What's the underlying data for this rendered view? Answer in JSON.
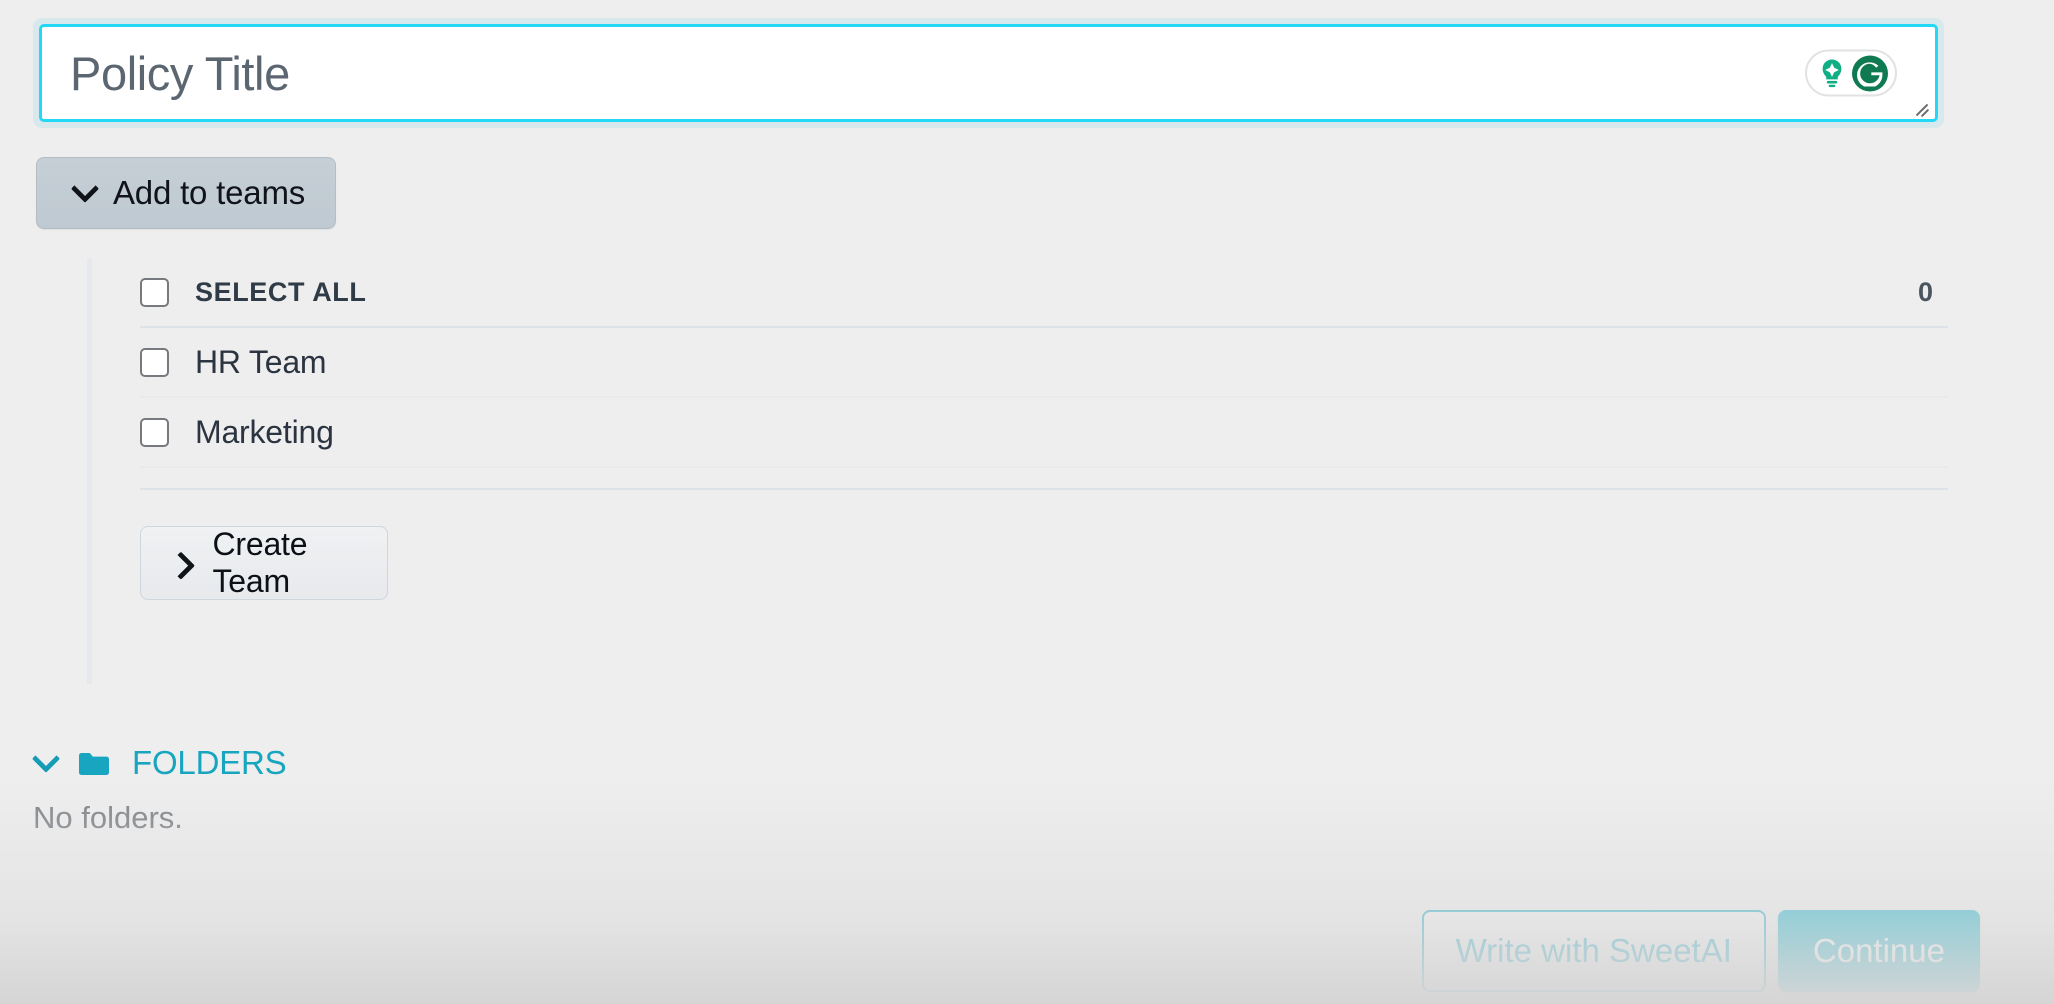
{
  "title_input": {
    "placeholder": "Policy Title",
    "value": "",
    "assistant_icons": [
      "grammarly-suggestion-bulb-icon",
      "grammarly-logo-icon"
    ]
  },
  "add_to_teams": {
    "label": "Add to teams",
    "chevron": "chevron-down-icon"
  },
  "teams_panel": {
    "select_all_label": "SELECT ALL",
    "selected_count": "0",
    "teams": [
      {
        "label": "HR Team",
        "checked": false
      },
      {
        "label": "Marketing",
        "checked": false
      }
    ],
    "create_team": {
      "label": "Create Team",
      "chevron": "chevron-right-icon"
    }
  },
  "folders": {
    "label": "FOLDERS",
    "icon": "folder-icon",
    "chevron": "chevron-down-icon",
    "empty_message": "No folders.",
    "accent_color": "#18a5bf"
  },
  "footer": {
    "secondary_label": "Write with SweetAI",
    "primary_label": "Continue"
  },
  "colors": {
    "page_background": "#eeeeee",
    "accent_teal": "#17b0c9",
    "focus_border": "#22d8f5",
    "text_dark": "#2b3440",
    "text_muted": "#7b7f83"
  }
}
